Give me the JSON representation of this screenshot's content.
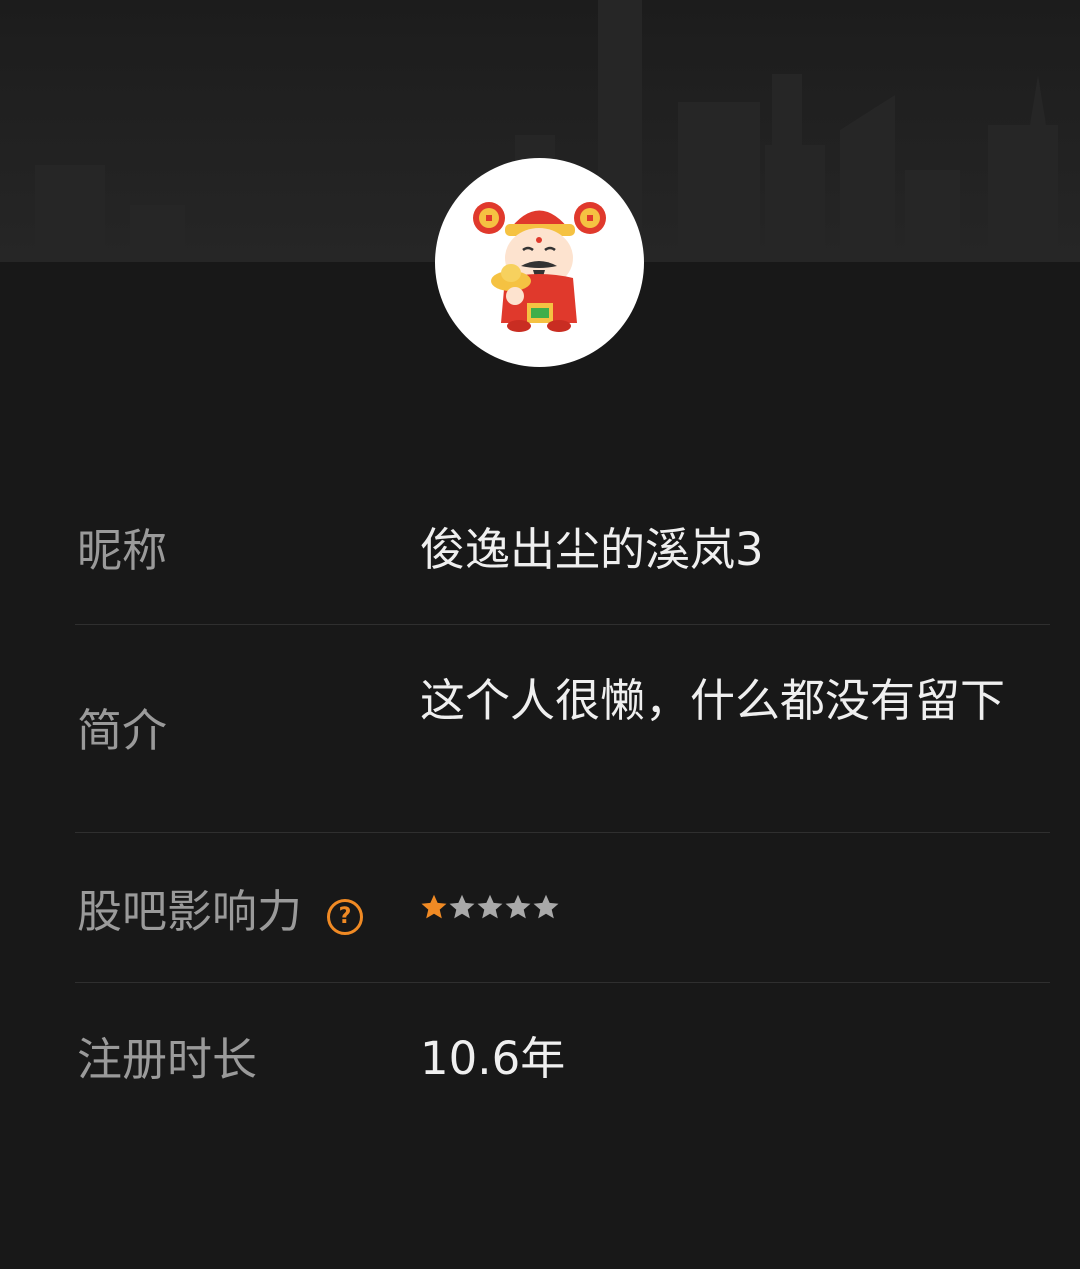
{
  "header": {
    "background": "city-skyline-silhouette"
  },
  "avatar": {
    "icon": "god-of-wealth-cartoon-avatar"
  },
  "profile": {
    "nickname": {
      "label": "昵称",
      "value": "俊逸出尘的溪岚3"
    },
    "bio": {
      "label": "简介",
      "value": "这个人很懒，什么都没有留下"
    },
    "influence": {
      "label": "股吧影响力",
      "help_icon": "question-circle-icon",
      "help_glyph": "?",
      "rating": 1,
      "max_rating": 5
    },
    "registration": {
      "label": "注册时长",
      "value": "10.6年"
    }
  },
  "colors": {
    "background": "#181818",
    "label": "#9a9a9a",
    "value": "#efefef",
    "accent": "#f08a24",
    "star_inactive": "#a9a9a9",
    "divider": "#2f2f2f"
  }
}
